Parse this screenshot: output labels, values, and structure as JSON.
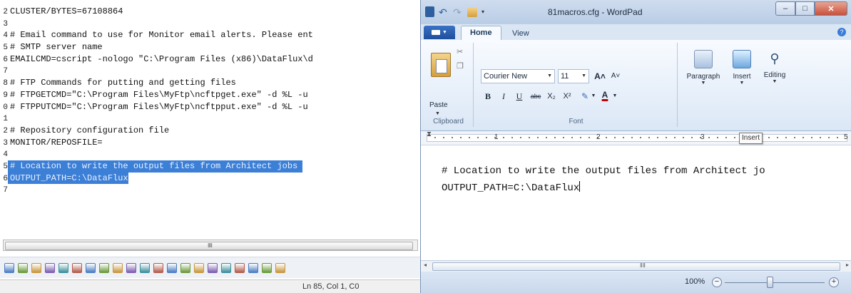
{
  "editor": {
    "lines": [
      {
        "gutter": "2",
        "text": "CLUSTER/BYTES=67108864",
        "selected": false
      },
      {
        "gutter": "3",
        "text": "",
        "selected": false
      },
      {
        "gutter": "4",
        "text": "# Email command to use for Monitor email alerts. Please ent",
        "selected": false
      },
      {
        "gutter": "5",
        "text": "# SMTP server name",
        "selected": false
      },
      {
        "gutter": "6",
        "text": "EMAILCMD=cscript -nologo \"C:\\Program Files (x86)\\DataFlux\\d",
        "selected": false
      },
      {
        "gutter": "7",
        "text": "",
        "selected": false
      },
      {
        "gutter": "8",
        "text": "# FTP Commands for putting and getting files",
        "selected": false
      },
      {
        "gutter": "9",
        "text": "# FTPGETCMD=\"C:\\Program Files\\MyFtp\\ncftpget.exe\" -d %L -u",
        "selected": false
      },
      {
        "gutter": "0",
        "text": "# FTPPUTCMD=\"C:\\Program Files\\MyFtp\\ncftpput.exe\" -d %L -u",
        "selected": false
      },
      {
        "gutter": "1",
        "text": "",
        "selected": false
      },
      {
        "gutter": "2",
        "text": "# Repository configuration file",
        "selected": false
      },
      {
        "gutter": "3",
        "text": "MONITOR/REPOSFILE=",
        "selected": false
      },
      {
        "gutter": "4",
        "text": "",
        "selected": false
      },
      {
        "gutter": "5",
        "text": "# Location to write the output files from Architect jobs ",
        "selected": true
      },
      {
        "gutter": "6",
        "text": "OUTPUT_PATH=C:\\DataFlux",
        "selected": true
      },
      {
        "gutter": "7",
        "text": "",
        "selected": false
      }
    ],
    "scroll_grip": "ⅡⅡ",
    "status_position": "Ln 85, Col 1, C0",
    "toolbar_icons": [
      "indent-icon",
      "bullets-icon",
      "bullets-icon",
      "bullets-icon",
      "bullets-icon",
      "image-icon",
      "line-icon",
      "table-icon",
      "table-icon",
      "table-icon",
      "chart-icon",
      "checkbox-icon",
      "radio-icon",
      "text-icon",
      "picture-icon",
      "anchor-icon",
      "link-icon",
      "code-icon",
      "template-icon",
      "more-icon",
      "grid-icon"
    ]
  },
  "wordpad": {
    "title": "81macros.cfg - WordPad",
    "tabs": {
      "home": "Home",
      "view": "View"
    },
    "clipboard": {
      "paste": "Paste",
      "group": "Clipboard"
    },
    "font": {
      "name": "Courier New",
      "size": "11",
      "group": "Font",
      "bold": "B",
      "italic": "I",
      "underline": "U",
      "strike": "abc",
      "subscript": "X₂",
      "superscript": "X²",
      "grow": "A˄",
      "shrink": "A˅"
    },
    "paragraph": {
      "label": "Paragraph"
    },
    "insert": {
      "label": "Insert"
    },
    "editing": {
      "label": "Editing"
    },
    "ruler": {
      "marks": [
        "1",
        "2",
        "3",
        "5"
      ],
      "tooltip": "Insert"
    },
    "document": {
      "lines": [
        "# Location to write the output files from Architect jo",
        "OUTPUT_PATH=C:\\DataFlux"
      ]
    },
    "zoom": "100%",
    "zoom_level": 0.45,
    "window_buttons": {
      "minimize": "–",
      "maximize": "□",
      "close": "✕"
    }
  }
}
